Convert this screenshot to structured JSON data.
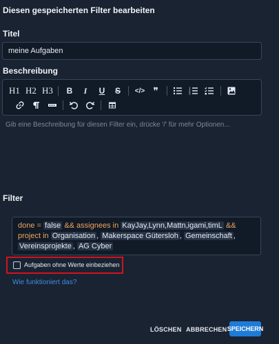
{
  "modal": {
    "title": "Diesen gespeicherten Filter bearbeiten"
  },
  "title_field": {
    "label": "Titel",
    "value": "meine Aufgaben"
  },
  "description": {
    "label": "Beschreibung",
    "placeholder": "Gib eine Beschreibung für diesen Filter ein, drücke '/' für mehr Optionen...",
    "toolbar": {
      "h1": "H1",
      "h2": "H2",
      "h3": "H3",
      "bold": "B",
      "italic": "I",
      "underline": "U",
      "strike": "S",
      "code": "</>",
      "quote": "❞",
      "icons": [
        "bullet-list-icon",
        "ordered-list-icon",
        "task-list-icon",
        "image-icon",
        "link-icon",
        "paragraph-icon",
        "horizontal-rule-icon",
        "undo-icon",
        "redo-icon",
        "table-icon"
      ]
    }
  },
  "filter": {
    "label": "Filter",
    "query": {
      "p1": "done = ",
      "v1": "false",
      "p2": " && assignees in ",
      "v2": "KayJay,Lynn,Mattn,igami,timL",
      "p3": " && ",
      "p4": "project in ",
      "v3": "Organisation",
      "p5": ", ",
      "v4": "Makerspace Gütersloh",
      "p6": ", ",
      "v5": "Gemeinschaft",
      "p7": ", ",
      "v6": "Vereinsprojekte",
      "p8": ", ",
      "v7": "AG Cyber"
    },
    "checkbox_label": "Aufgaben ohne Werte einbeziehen",
    "checkbox_checked": false,
    "help_link": "Wie funktioniert das?"
  },
  "actions": {
    "delete": "LÖSCHEN",
    "cancel": "ABBRECHEN",
    "save": "SPEICHERN"
  },
  "colors": {
    "background": "#1a2332",
    "accent": "#1f7bd8",
    "highlight": "#d3121f",
    "keyword": "#f0a35e"
  }
}
